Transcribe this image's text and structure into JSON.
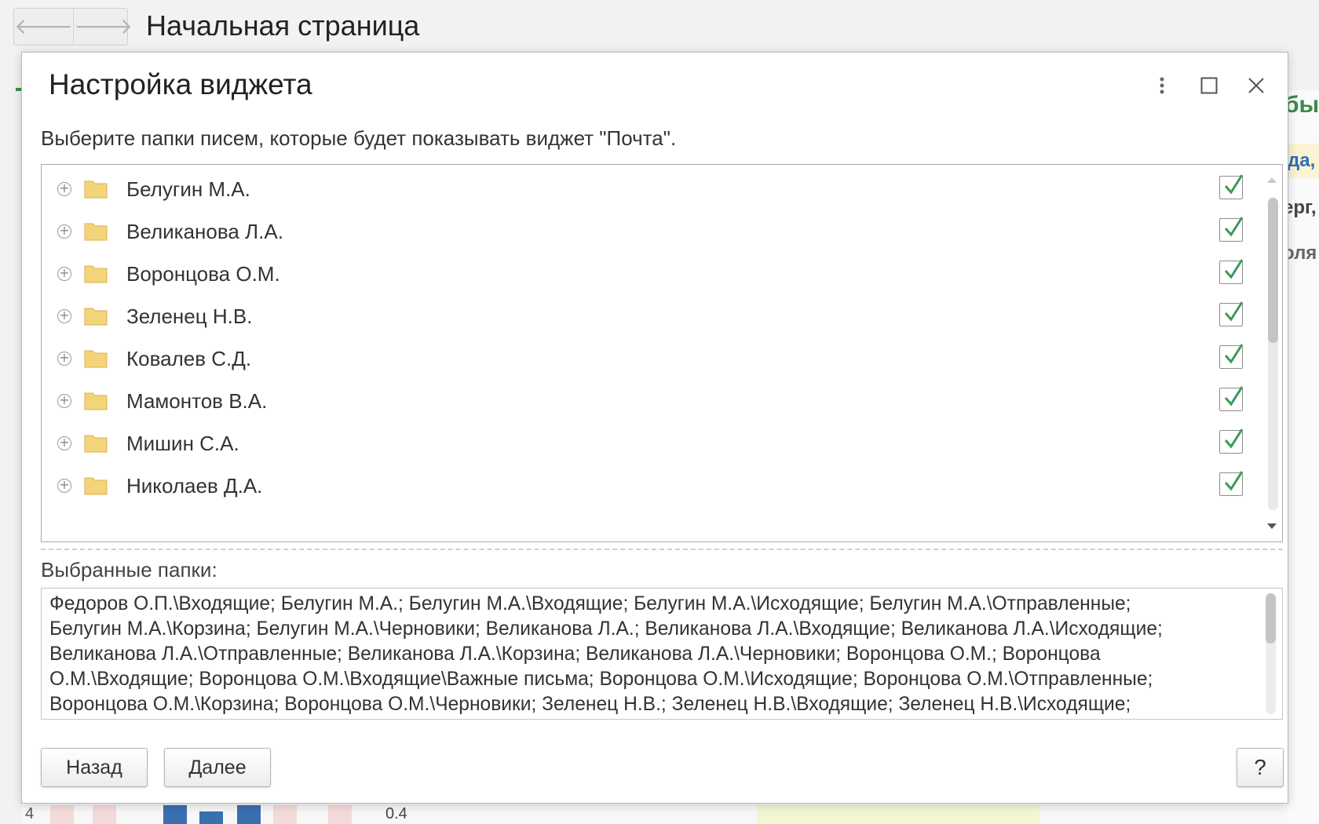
{
  "page": {
    "title": "Начальная страница",
    "back_glyph": "🡐",
    "forward_glyph": "🡒",
    "right_fragments": [
      "быт",
      "да,",
      "ерг,",
      "оля"
    ],
    "bottom_fragments": [
      "4",
      "0.4"
    ]
  },
  "dialog": {
    "title": "Настройка виджета",
    "menu_icon": "more-vertical-icon",
    "maximize_icon": "maximize-icon",
    "close_icon": "close-icon",
    "instruction": "Выберите папки писем, которые будет показывать виджет \"Почта\".",
    "folders": [
      {
        "name": "Белугин М.А.",
        "checked": true
      },
      {
        "name": "Великанова Л.А.",
        "checked": true
      },
      {
        "name": "Воронцова О.М.",
        "checked": true
      },
      {
        "name": "Зеленец Н.В.",
        "checked": true
      },
      {
        "name": "Ковалев С.Д.",
        "checked": true
      },
      {
        "name": "Мамонтов В.А.",
        "checked": true
      },
      {
        "name": "Мишин С.А.",
        "checked": true
      },
      {
        "name": "Николаев Д.А.",
        "checked": true
      }
    ],
    "selected_label": "Выбранные папки:",
    "selected_lines": [
      "Федоров О.П.\\Входящие; Белугин М.А.; Белугин М.А.\\Входящие; Белугин М.А.\\Исходящие; Белугин М.А.\\Отправленные;",
      "Белугин М.А.\\Корзина; Белугин М.А.\\Черновики; Великанова Л.А.; Великанова Л.А.\\Входящие; Великанова Л.А.\\Исходящие;",
      "Великанова Л.А.\\Отправленные; Великанова Л.А.\\Корзина; Великанова Л.А.\\Черновики; Воронцова О.М.; Воронцова",
      "О.М.\\Входящие; Воронцова О.М.\\Входящие\\Важные письма; Воронцова О.М.\\Исходящие; Воронцова О.М.\\Отправленные;",
      "Воронцова О.М.\\Корзина; Воронцова О.М.\\Черновики; Зеленец Н.В.; Зеленец Н.В.\\Входящие; Зеленец Н.В.\\Исходящие;"
    ],
    "back_label": "Назад",
    "next_label": "Далее",
    "help_label": "?"
  },
  "colors": {
    "checkmark": "#3a9a5a",
    "folder": "#f3d47a",
    "accent_link": "#2f6fb5"
  }
}
